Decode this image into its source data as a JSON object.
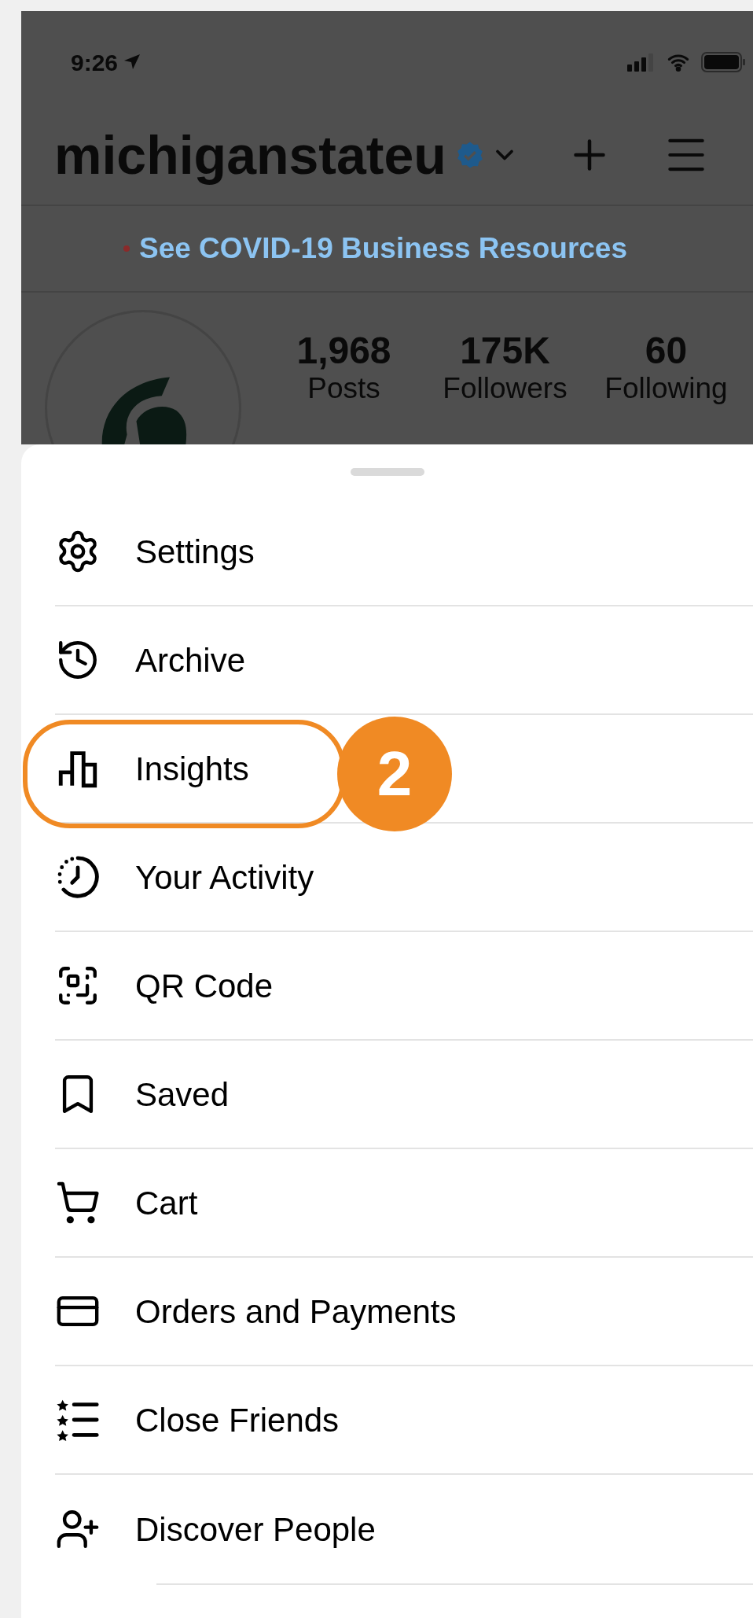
{
  "status_bar": {
    "time": "9:26"
  },
  "header": {
    "username": "michiganstateu",
    "verified": true
  },
  "banner": {
    "text": "See COVID-19 Business Resources"
  },
  "profile": {
    "stats": [
      {
        "value": "1,968",
        "label": "Posts"
      },
      {
        "value": "175K",
        "label": "Followers"
      },
      {
        "value": "60",
        "label": "Following"
      }
    ]
  },
  "menu": {
    "items": [
      {
        "label": "Settings",
        "highlighted": false
      },
      {
        "label": "Archive",
        "highlighted": false
      },
      {
        "label": "Insights",
        "highlighted": true,
        "callout": "2"
      },
      {
        "label": "Your Activity",
        "highlighted": false
      },
      {
        "label": "QR Code",
        "highlighted": false
      },
      {
        "label": "Saved",
        "highlighted": false
      },
      {
        "label": "Cart",
        "highlighted": false
      },
      {
        "label": "Orders and Payments",
        "highlighted": false
      },
      {
        "label": "Close Friends",
        "highlighted": false
      },
      {
        "label": "Discover People",
        "highlighted": false
      }
    ]
  }
}
